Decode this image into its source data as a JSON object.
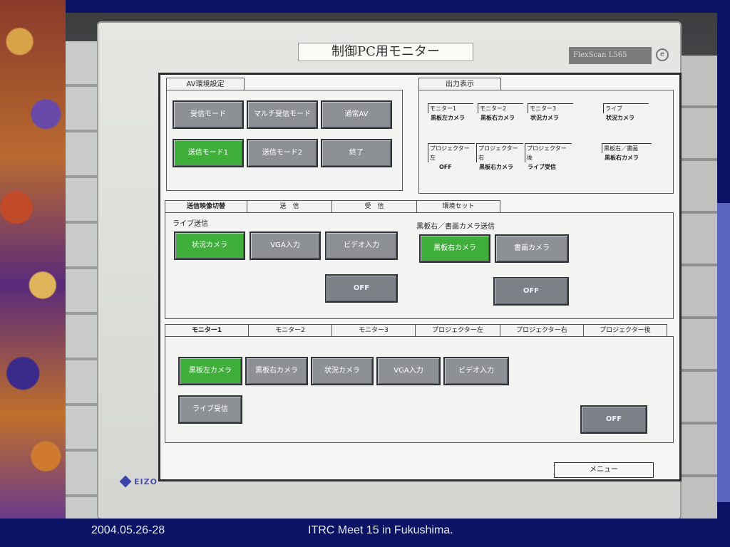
{
  "monitor": {
    "label": "制御PC用モニター",
    "model": "FlexScan L565",
    "power_glyph": "e",
    "brand": "EIZO"
  },
  "av_settings": {
    "tab": "AV環境設定",
    "buttons": [
      "受信モード",
      "マルチ受信モード",
      "通常AV",
      "送信モード1",
      "送信モード2",
      "終了"
    ]
  },
  "output_display": {
    "tab": "出力表示",
    "items": [
      {
        "head": "モニター1",
        "value": "黒板左カメラ"
      },
      {
        "head": "モニター2",
        "value": "黒板右カメラ"
      },
      {
        "head": "モニター3",
        "value": "状況カメラ"
      },
      {
        "head": "ライブ",
        "value": "状況カメラ"
      },
      {
        "head": "プロジェクター左",
        "value": "OFF"
      },
      {
        "head": "プロジェクター右",
        "value": "黒板右カメラ"
      },
      {
        "head": "プロジェクター後",
        "value": "ライブ受信"
      },
      {
        "head": "黒板右／書画",
        "value": "黒板右カメラ"
      }
    ]
  },
  "send_tabs": [
    "送信映像切替",
    "送　信",
    "受　信",
    "環境セット"
  ],
  "send_panel": {
    "live_label": "ライブ送信",
    "live_buttons": [
      "状況カメラ",
      "VGA入力",
      "ビデオ入力"
    ],
    "live_off": "OFF",
    "board_label": "黒板右／書画カメラ送信",
    "board_buttons": [
      "黒板右カメラ",
      "書画カメラ"
    ],
    "board_off": "OFF"
  },
  "monitor_tabs": [
    "モニター1",
    "モニター2",
    "モニター3",
    "プロジェクター左",
    "プロジェクター右",
    "プロジェクター後"
  ],
  "monitor_panel": {
    "buttons": [
      "黒板左カメラ",
      "黒板右カメラ",
      "状況カメラ",
      "VGA入力",
      "ビデオ入力"
    ],
    "live_recv": "ライブ受信",
    "off": "OFF"
  },
  "menu_button": "メニュー",
  "footer": {
    "date": "2004.05.26-28",
    "title": "ITRC Meet 15 in Fukushima."
  },
  "colors": {
    "slide_bg": "#0b1464",
    "active_green": "#3fae3a",
    "button_gray": "#8d9196"
  }
}
